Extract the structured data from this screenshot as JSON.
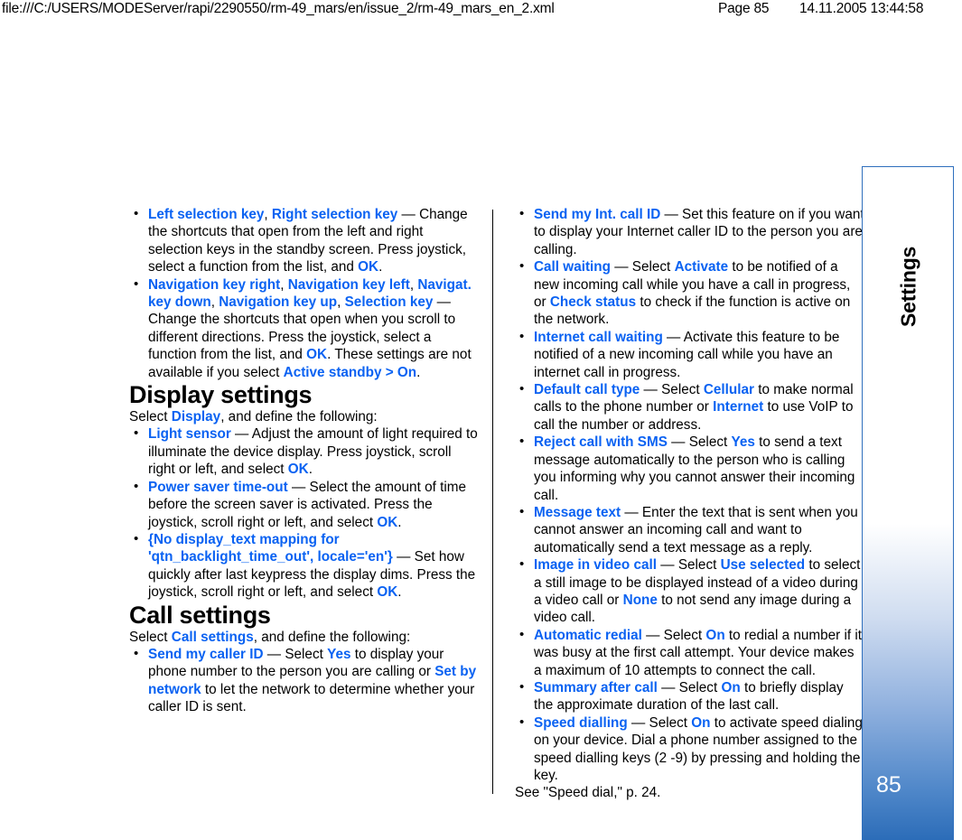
{
  "print_header": {
    "url": "file:///C:/USERS/MODEServer/rapi/2290550/rm-49_mars/en/issue_2/rm-49_mars_en_2.xml",
    "page": "Page 85",
    "timestamp": "14.11.2005 13:44:58"
  },
  "chapter_tab": {
    "label": "Settings",
    "page_number": "85",
    "border_color": "#2f6fbd",
    "gradient_bottom_color": "#2b6cb8",
    "page_number_color": "#ffffff"
  },
  "colors": {
    "keyword_blue": "#0a62f2",
    "body_text": "#000000"
  },
  "left_column": {
    "top_bullets": [
      {
        "parts": [
          {
            "t": "Left selection key",
            "s": "kw"
          },
          {
            "t": ", ",
            "s": "plain"
          },
          {
            "t": "Right selection key",
            "s": "kw"
          },
          {
            "t": " — Change the shortcuts that open from the left and right selection keys in the standby screen. Press joystick, select a function from the list, and ",
            "s": "plain"
          },
          {
            "t": "OK",
            "s": "kw"
          },
          {
            "t": ".",
            "s": "plain"
          }
        ]
      },
      {
        "parts": [
          {
            "t": "Navigation key right",
            "s": "kw"
          },
          {
            "t": ", ",
            "s": "plain"
          },
          {
            "t": "Navigation key left",
            "s": "kw"
          },
          {
            "t": ", ",
            "s": "plain"
          },
          {
            "t": "Navigat. key down",
            "s": "kw"
          },
          {
            "t": ", ",
            "s": "plain"
          },
          {
            "t": "Navigation key up",
            "s": "kw"
          },
          {
            "t": ", ",
            "s": "plain"
          },
          {
            "t": "Selection key",
            "s": "kw"
          },
          {
            "t": " — Change the shortcuts that open when you scroll to different directions. Press the joystick, select a function from the list, and ",
            "s": "plain"
          },
          {
            "t": "OK",
            "s": "kw"
          },
          {
            "t": ". These settings are not available if you select ",
            "s": "plain"
          },
          {
            "t": "Active standby",
            "s": "kw"
          },
          {
            "t": " > ",
            "s": "gt"
          },
          {
            "t": "On",
            "s": "kw"
          },
          {
            "t": ".",
            "s": "plain"
          }
        ]
      }
    ],
    "display_settings": {
      "heading": "Display settings",
      "intro_parts": [
        {
          "t": "Select ",
          "s": "plain"
        },
        {
          "t": "Display",
          "s": "kw"
        },
        {
          "t": ", and define the following:",
          "s": "plain"
        }
      ],
      "bullets": [
        {
          "parts": [
            {
              "t": "Light sensor",
              "s": "kw"
            },
            {
              "t": " — Adjust the amount of light required to illuminate the device display. Press joystick, scroll right or left, and select ",
              "s": "plain"
            },
            {
              "t": "OK",
              "s": "kw"
            },
            {
              "t": ".",
              "s": "plain"
            }
          ]
        },
        {
          "parts": [
            {
              "t": "Power saver time-out",
              "s": "kw"
            },
            {
              "t": " — Select the amount of time before the screen saver is activated. Press the joystick, scroll right or left, and select ",
              "s": "plain"
            },
            {
              "t": "OK",
              "s": "kw"
            },
            {
              "t": ".",
              "s": "plain"
            }
          ]
        },
        {
          "parts": [
            {
              "t": "{No display_text mapping for 'qtn_backlight_time_out', locale='en'}",
              "s": "kw"
            },
            {
              "t": " — Set how quickly after last keypress the display dims. Press the joystick, scroll right or left, and select ",
              "s": "plain"
            },
            {
              "t": "OK",
              "s": "kw"
            },
            {
              "t": ".",
              "s": "plain"
            }
          ]
        }
      ]
    },
    "call_settings": {
      "heading": "Call settings",
      "intro_parts": [
        {
          "t": "Select ",
          "s": "plain"
        },
        {
          "t": "Call settings",
          "s": "kw"
        },
        {
          "t": ", and define the following:",
          "s": "plain"
        }
      ],
      "bullets": [
        {
          "parts": [
            {
              "t": "Send my caller ID",
              "s": "kw"
            },
            {
              "t": " — Select ",
              "s": "plain"
            },
            {
              "t": "Yes",
              "s": "kw"
            },
            {
              "t": " to display your phone number to the person you are calling or ",
              "s": "plain"
            },
            {
              "t": "Set by network",
              "s": "kw"
            },
            {
              "t": " to let the network to determine whether your caller ID is sent.",
              "s": "plain"
            }
          ]
        }
      ]
    }
  },
  "right_column": {
    "bullets": [
      {
        "parts": [
          {
            "t": "Send my Int. call ID",
            "s": "kw"
          },
          {
            "t": " — Set this feature on if you want to display your Internet caller ID to the person you are calling.",
            "s": "plain"
          }
        ]
      },
      {
        "parts": [
          {
            "t": "Call waiting",
            "s": "kw"
          },
          {
            "t": " — Select ",
            "s": "plain"
          },
          {
            "t": "Activate",
            "s": "kw"
          },
          {
            "t": " to be notified of a new incoming call while you have a call in progress, or ",
            "s": "plain"
          },
          {
            "t": "Check status",
            "s": "kw"
          },
          {
            "t": " to check if the function is active on the network.",
            "s": "plain"
          }
        ]
      },
      {
        "parts": [
          {
            "t": "Internet call waiting",
            "s": "kw"
          },
          {
            "t": " — Activate this feature to be notified of a new incoming call while you have an internet call in progress.",
            "s": "plain"
          }
        ]
      },
      {
        "parts": [
          {
            "t": "Default call type",
            "s": "kw"
          },
          {
            "t": " — Select ",
            "s": "plain"
          },
          {
            "t": "Cellular",
            "s": "kw"
          },
          {
            "t": " to make normal calls to the phone number or ",
            "s": "plain"
          },
          {
            "t": "Internet",
            "s": "kw"
          },
          {
            "t": " to use VoIP to call the number or address.",
            "s": "plain"
          }
        ]
      },
      {
        "parts": [
          {
            "t": "Reject call with SMS",
            "s": "kw"
          },
          {
            "t": " — Select ",
            "s": "plain"
          },
          {
            "t": "Yes",
            "s": "kw"
          },
          {
            "t": " to send a text message automatically to the person who is calling you informing why you cannot answer their incoming call.",
            "s": "plain"
          }
        ]
      },
      {
        "parts": [
          {
            "t": "Message text",
            "s": "kw"
          },
          {
            "t": " — Enter the text that is sent when you cannot answer an incoming call and want to automatically send a text message as a reply.",
            "s": "plain"
          }
        ]
      },
      {
        "parts": [
          {
            "t": "Image in video call",
            "s": "kw"
          },
          {
            "t": " — Select ",
            "s": "plain"
          },
          {
            "t": "Use selected",
            "s": "kw"
          },
          {
            "t": " to select a still image to be displayed instead of a video during a video call or ",
            "s": "plain"
          },
          {
            "t": "None",
            "s": "kw"
          },
          {
            "t": " to not send any image during a video call.",
            "s": "plain"
          }
        ]
      },
      {
        "parts": [
          {
            "t": "Automatic redial",
            "s": "kw"
          },
          {
            "t": " — Select ",
            "s": "plain"
          },
          {
            "t": "On",
            "s": "kw"
          },
          {
            "t": " to redial a number if it was busy at the first call attempt. Your device makes a maximum of 10 attempts to connect the call.",
            "s": "plain"
          }
        ]
      },
      {
        "parts": [
          {
            "t": "Summary after call",
            "s": "kw"
          },
          {
            "t": " — Select ",
            "s": "plain"
          },
          {
            "t": "On",
            "s": "kw"
          },
          {
            "t": " to briefly display the approximate duration of the last call.",
            "s": "plain"
          }
        ]
      },
      {
        "parts": [
          {
            "t": "Speed dialling",
            "s": "kw"
          },
          {
            "t": " — Select ",
            "s": "plain"
          },
          {
            "t": "On",
            "s": "kw"
          },
          {
            "t": " to activate speed dialing on your device. Dial a phone number assigned to the speed dialling keys (2 -9) by pressing and holding the key.",
            "s": "plain"
          }
        ]
      }
    ],
    "cross_reference": "See \"Speed dial,\" p. 24."
  }
}
